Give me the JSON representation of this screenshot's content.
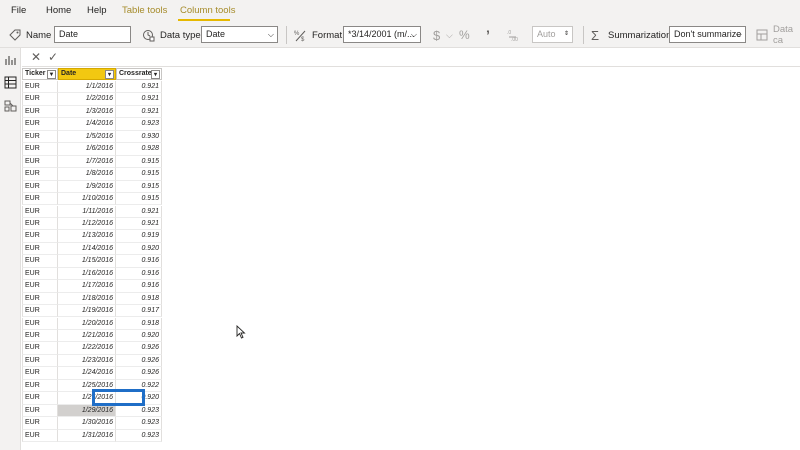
{
  "menu": {
    "tabs": [
      {
        "label": "File"
      },
      {
        "label": "Home"
      },
      {
        "label": "Help"
      },
      {
        "label": "Table tools"
      },
      {
        "label": "Column tools"
      }
    ]
  },
  "ribbon": {
    "name_label": "Name",
    "name_value": "Date",
    "datatype_label": "Data type",
    "datatype_value": "Date",
    "format_label": "Format",
    "format_value": "*3/14/2001 (m/...",
    "currency_symbol": "$",
    "percent_symbol": "%",
    "comma_symbol": "’",
    "decimals_value": "Auto",
    "summarization_label": "Summarization",
    "summarization_value": "Don't summarize",
    "data_category_label": "Data ca"
  },
  "table": {
    "columns": [
      "Ticker",
      "Date",
      "Crossrate"
    ],
    "rows": [
      {
        "ticker": "EUR",
        "date": "1/1/2016",
        "rate": "0.921"
      },
      {
        "ticker": "EUR",
        "date": "1/2/2016",
        "rate": "0.921"
      },
      {
        "ticker": "EUR",
        "date": "1/3/2016",
        "rate": "0.921"
      },
      {
        "ticker": "EUR",
        "date": "1/4/2016",
        "rate": "0.923"
      },
      {
        "ticker": "EUR",
        "date": "1/5/2016",
        "rate": "0.930"
      },
      {
        "ticker": "EUR",
        "date": "1/6/2016",
        "rate": "0.928"
      },
      {
        "ticker": "EUR",
        "date": "1/7/2016",
        "rate": "0.915"
      },
      {
        "ticker": "EUR",
        "date": "1/8/2016",
        "rate": "0.915"
      },
      {
        "ticker": "EUR",
        "date": "1/9/2016",
        "rate": "0.915"
      },
      {
        "ticker": "EUR",
        "date": "1/10/2016",
        "rate": "0.915"
      },
      {
        "ticker": "EUR",
        "date": "1/11/2016",
        "rate": "0.921"
      },
      {
        "ticker": "EUR",
        "date": "1/12/2016",
        "rate": "0.921"
      },
      {
        "ticker": "EUR",
        "date": "1/13/2016",
        "rate": "0.919"
      },
      {
        "ticker": "EUR",
        "date": "1/14/2016",
        "rate": "0.920"
      },
      {
        "ticker": "EUR",
        "date": "1/15/2016",
        "rate": "0.916"
      },
      {
        "ticker": "EUR",
        "date": "1/16/2016",
        "rate": "0.916"
      },
      {
        "ticker": "EUR",
        "date": "1/17/2016",
        "rate": "0.916"
      },
      {
        "ticker": "EUR",
        "date": "1/18/2016",
        "rate": "0.918"
      },
      {
        "ticker": "EUR",
        "date": "1/19/2016",
        "rate": "0.917"
      },
      {
        "ticker": "EUR",
        "date": "1/20/2016",
        "rate": "0.918"
      },
      {
        "ticker": "EUR",
        "date": "1/21/2016",
        "rate": "0.920"
      },
      {
        "ticker": "EUR",
        "date": "1/22/2016",
        "rate": "0.926"
      },
      {
        "ticker": "EUR",
        "date": "1/23/2016",
        "rate": "0.926"
      },
      {
        "ticker": "EUR",
        "date": "1/24/2016",
        "rate": "0.926"
      },
      {
        "ticker": "EUR",
        "date": "1/25/2016",
        "rate": "0.922"
      },
      {
        "ticker": "EUR",
        "date": "1/26/2016",
        "rate": "0.920"
      },
      {
        "ticker": "EUR",
        "date": "1/29/2016",
        "rate": "0.923"
      },
      {
        "ticker": "EUR",
        "date": "1/30/2016",
        "rate": "0.923"
      },
      {
        "ticker": "EUR",
        "date": "1/31/2016",
        "rate": "0.923"
      }
    ]
  },
  "colors": {
    "accent": "#f2c811",
    "selection": "#1f6ec7",
    "tab_active": "#a68c2b"
  }
}
